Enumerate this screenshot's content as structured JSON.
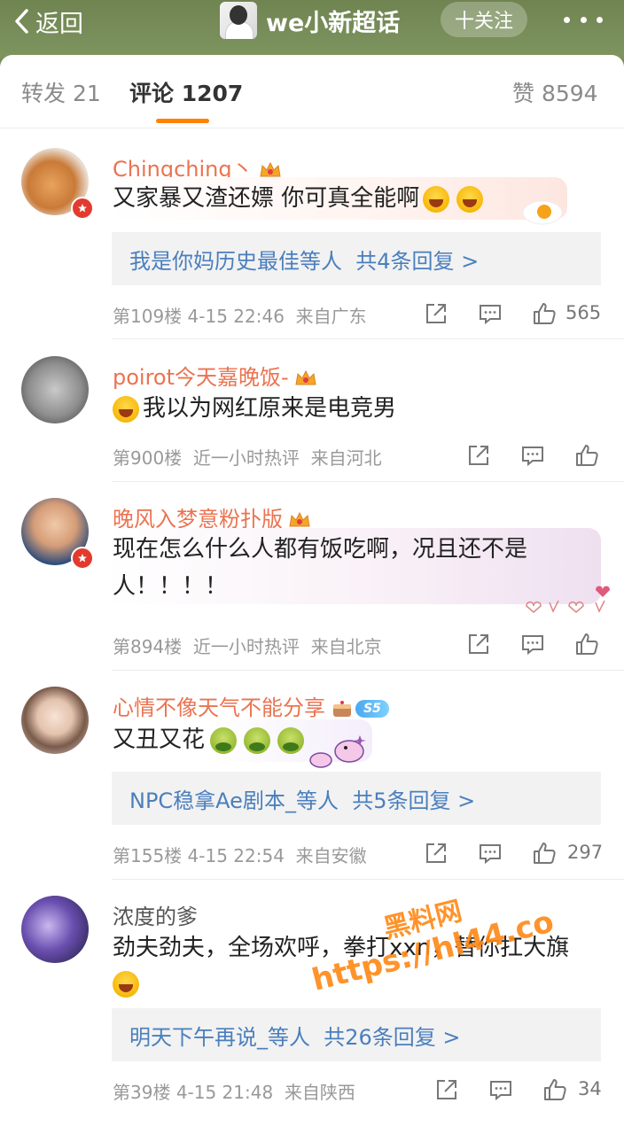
{
  "header": {
    "back_label": "返回",
    "title": "we小新超话",
    "follow_label": "十关注",
    "colors": {
      "bar": "#7a8f5a"
    }
  },
  "tabs": {
    "repost": "转发 21",
    "comments": "评论 1207",
    "likes": "赞 8594",
    "accent": "#ff8200"
  },
  "comments": [
    {
      "name": "Chingching丶",
      "text": "又家暴又渣还嫖 你可真全能啊",
      "emojis": [
        "laugh",
        "laugh"
      ],
      "reply_names": "我是你妈历史最佳等人",
      "reply_count": "共4条回复 >",
      "floor": "第109楼",
      "time": "4-15 22:46",
      "location": "来自广东",
      "likes": "565"
    },
    {
      "name": "poirot今天嘉晚饭-",
      "text": "我以为网红原来是电竞男",
      "emojis": [
        "laugh"
      ],
      "floor": "第900楼",
      "time": "近一小时热评",
      "location": "来自河北"
    },
    {
      "name": "晚风入梦意粉扑版",
      "text_line1": "现在怎么什么人都有饭吃啊，况且还不是",
      "text_line2": "人！！！！",
      "floor": "第894楼",
      "time": "近一小时热评",
      "location": "来自北京"
    },
    {
      "name": "心情不像天气不能分享",
      "level_badge": "S5",
      "text": "又丑又花",
      "emojis": [
        "sick",
        "sick",
        "sick"
      ],
      "reply_names": "NPC稳拿Ae剧本_等人",
      "reply_count": "共5条回复 >",
      "floor": "第155楼",
      "time": "4-15 22:54",
      "location": "来自安徽",
      "likes": "297"
    },
    {
      "name": "浓度的爹",
      "text_line1": "劲夫劲夫，全场欢呼，拳打xxn，替你扛大旗",
      "emojis": [
        "laugh"
      ],
      "reply_names": "明天下午再说_等人",
      "reply_count": "共26条回复 >",
      "floor": "第39楼",
      "time": "4-15 21:48",
      "location": "来自陕西",
      "likes": "34"
    }
  ],
  "watermark": {
    "line1": "黑料网",
    "line2": "https://hl44.co"
  }
}
